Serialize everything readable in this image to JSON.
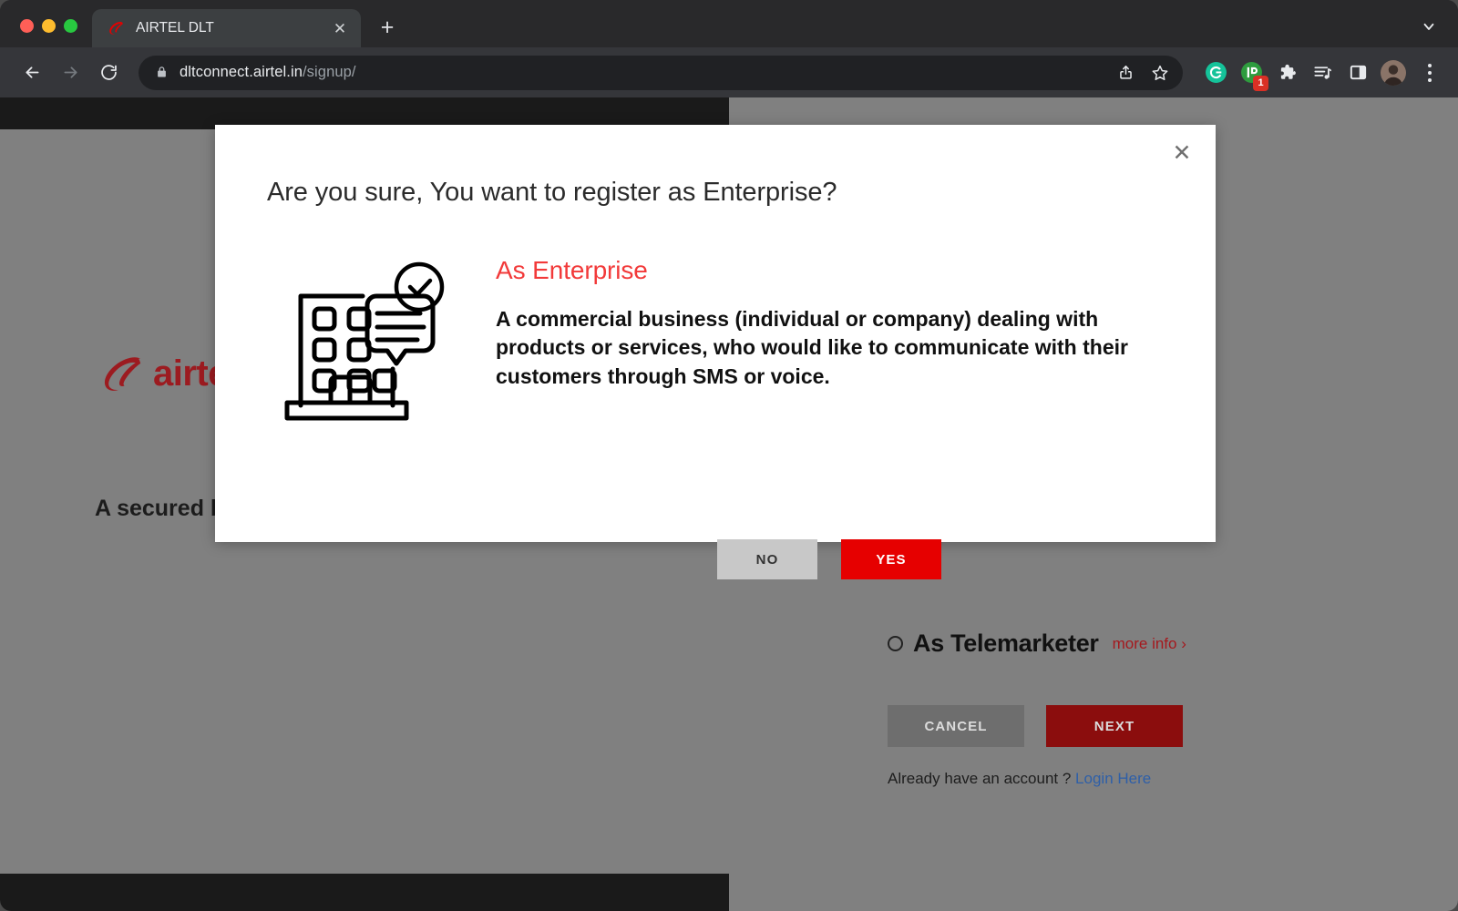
{
  "browser": {
    "tab": {
      "title": "AIRTEL DLT",
      "favicon_icon": "airtel-swoosh-icon",
      "close_icon": "✕"
    },
    "new_tab_icon": "+",
    "tabstrip_menu_icon": "chevron-down-icon",
    "nav": {
      "back_icon": "←",
      "forward_icon": "→",
      "reload_icon": "⟳"
    },
    "omnibox": {
      "lock_icon": "lock-icon",
      "url_domain": "dltconnect.airtel.in",
      "url_path": "/signup/",
      "share_icon": "share-icon",
      "bookmark_icon": "star-icon"
    },
    "extensions": [
      {
        "name": "grammarly-extension-icon",
        "glyph": "G",
        "color": "#15c39a",
        "badge": ""
      },
      {
        "name": "instapaper-extension-icon",
        "glyph": "IP",
        "color": "#2e9c3e",
        "badge": "1"
      },
      {
        "name": "extensions-puzzle-icon",
        "glyph": "puzzle",
        "color": "#e8eaed",
        "badge": ""
      },
      {
        "name": "media-playlist-icon",
        "glyph": "playlist",
        "color": "#e8eaed",
        "badge": ""
      },
      {
        "name": "side-panel-icon",
        "glyph": "panel",
        "color": "#e8eaed",
        "badge": ""
      }
    ],
    "profile_avatar_name": "profile-avatar",
    "menu_icon": "three-dot-menu-icon"
  },
  "page": {
    "brand_name": "airtel",
    "hero_text": "A secured b\ncommercia",
    "option": {
      "label": "As Telemarketer",
      "more_info": "more info ›",
      "selected": false
    },
    "buttons": {
      "cancel": "CANCEL",
      "next": "NEXT"
    },
    "account_prompt": "Already have an account ?",
    "login_link": "Login Here"
  },
  "modal": {
    "close_icon": "✕",
    "title": "Are you sure, You want to register as Enterprise?",
    "illustration_name": "enterprise-building-illustration",
    "heading": "As Enterprise",
    "description": "A commercial business (individual or company) dealing with products or services, who would like to communicate with their customers through SMS or voice.",
    "buttons": {
      "no": "NO",
      "yes": "YES"
    }
  },
  "colors": {
    "airtel_red": "#e60000",
    "modal_heading_red": "#f23a3a",
    "next_button_red": "#8b0d0d",
    "overlay_gray": "#808080",
    "link_blue": "#2e5fa8"
  }
}
